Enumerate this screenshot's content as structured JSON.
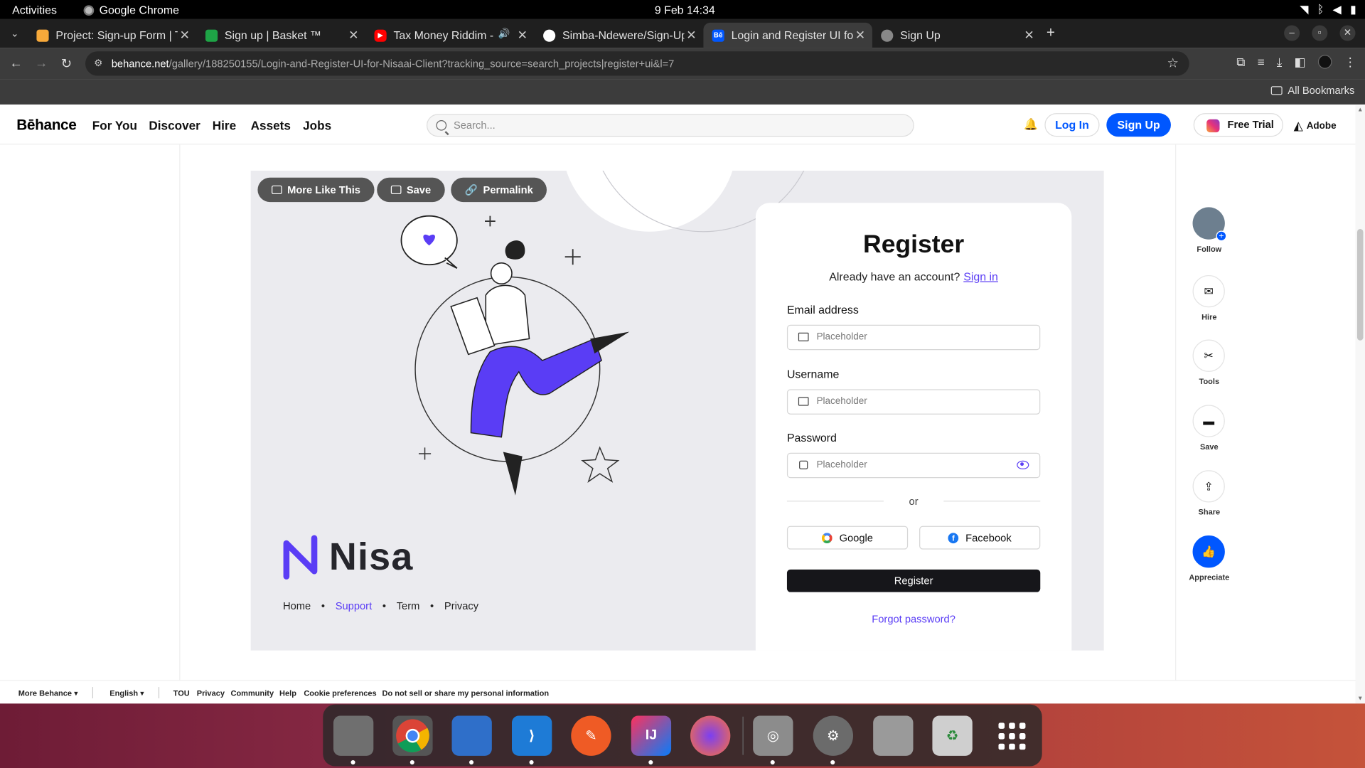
{
  "system": {
    "activities": "Activities",
    "app_name": "Google Chrome",
    "clock": "9 Feb  14:34"
  },
  "tabs": [
    {
      "title": "Project: Sign-up Form | T",
      "fav_color": "#f7a93a"
    },
    {
      "title": "Sign up | Basket ™",
      "fav_color": "#1ea446"
    },
    {
      "title": "Tax Money Riddim - m",
      "fav_color": "#ff0000"
    },
    {
      "title": "Simba-Ndewere/Sign-Up",
      "fav_color": "#ffffff"
    },
    {
      "title": "Login and Register UI fo",
      "fav_color": "#0057ff",
      "fav_text": "Bē"
    },
    {
      "title": "Sign Up",
      "fav_color": "#888888"
    }
  ],
  "url": {
    "domain": "behance.net",
    "path": "/gallery/188250155/Login-and-Register-UI-for-Nisaai-Client?tracking_source=search_projects|register+ui&l=7"
  },
  "bookmarks": {
    "all": "All Bookmarks"
  },
  "behance": {
    "logo": "Bēhance",
    "nav": [
      "For You",
      "Discover",
      "Hire",
      "Assets",
      "Jobs"
    ],
    "search_placeholder": "Search...",
    "login": "Log In",
    "signup": "Sign Up",
    "trial": "Free Trial",
    "adobe": "Adobe"
  },
  "project": {
    "actions": [
      "More Like This",
      "Save",
      "Permalink"
    ],
    "brand": "Nisa",
    "footer_nav": [
      "Home",
      "Support",
      "Term",
      "Privacy"
    ],
    "form": {
      "title": "Register",
      "subtitle": "Already have an account?",
      "signin": "Sign in",
      "email_label": "Email address",
      "username_label": "Username",
      "password_label": "Password",
      "placeholder": "Placeholder",
      "or": "or",
      "google": "Google",
      "facebook": "Facebook",
      "register": "Register",
      "forgot": "Forgot password?"
    }
  },
  "rail": [
    "Follow",
    "Hire",
    "Tools",
    "Save",
    "Share",
    "Appreciate"
  ],
  "footer": {
    "more": "More Behance ▾",
    "lang": "English ▾",
    "links": [
      "TOU",
      "Privacy",
      "Community",
      "Help",
      "Cookie preferences",
      "Do not sell or share my personal information"
    ]
  },
  "accent": "#5a3df5",
  "brand_blue": "#0057ff"
}
